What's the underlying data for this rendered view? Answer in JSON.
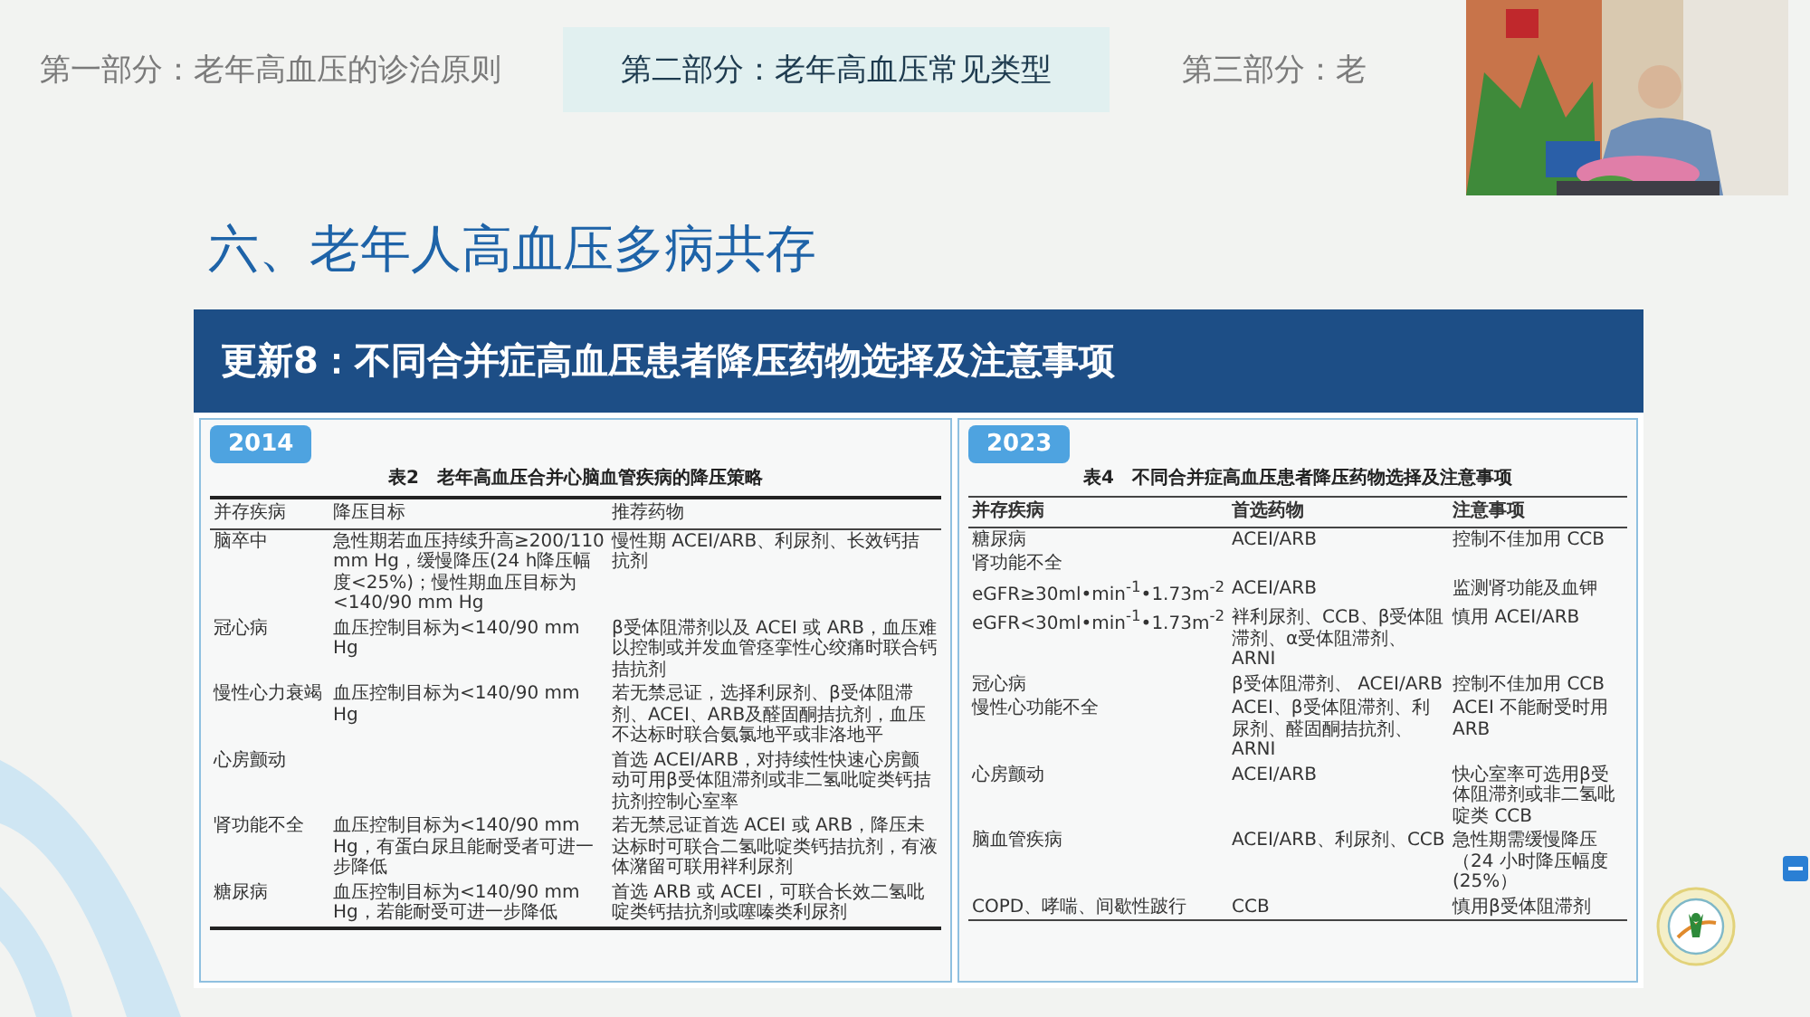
{
  "nav": {
    "tabs": [
      {
        "label": "第一部分：老年高血压的诊治原则",
        "selected": false
      },
      {
        "label": "第二部分：老年高血压常见类型",
        "selected": true
      },
      {
        "label": "第三部分：老",
        "selected": false
      }
    ]
  },
  "heading": "六、老年人高血压多病共存",
  "banner": "更新8：不同合并症高血压患者降压药物选择及注意事项",
  "panels": [
    {
      "year": "2014",
      "kind": "old",
      "table": {
        "title": "表2　老年高血压合并心脑血管疾病的降压策略",
        "columns": [
          "并存疾病",
          "降压目标",
          "推荐药物"
        ],
        "rows": [
          [
            "脑卒中",
            "急性期若血压持续升高≥200/110 mm Hg，缓慢降压(24 h降压幅度<25%)；慢性期血压目标为<140/90 mm Hg",
            "慢性期 ACEI/ARB、利尿剂、长效钙拮抗剂"
          ],
          [
            "冠心病",
            "血压控制目标为<140/90 mm Hg",
            "β受体阻滞剂以及 ACEI 或 ARB，血压难以控制或并发血管痉挛性心绞痛时联合钙拮抗剂"
          ],
          [
            "慢性心力衰竭",
            "血压控制目标为<140/90 mm Hg",
            "若无禁忌证，选择利尿剂、β受体阻滞剂、ACEI、ARB及醛固酮拮抗剂，血压不达标时联合氨氯地平或非洛地平"
          ],
          [
            "心房颤动",
            null,
            "首选 ACEI/ARB，对持续性快速心房颤动可用β受体阻滞剂或非二氢吡啶类钙拮抗剂控制心室率"
          ],
          [
            "肾功能不全",
            "血压控制目标为<140/90 mm Hg，有蛋白尿且能耐受者可进一步降低",
            "若无禁忌证首选 ACEI 或 ARB，降压未达标时可联合二氢吡啶类钙拮抗剂，有液体潴留可联用袢利尿剂"
          ],
          [
            "糖尿病",
            "血压控制目标为<140/90 mm Hg，若能耐受可进一步降低",
            "首选 ARB 或 ACEI，可联合长效二氢吡啶类钙拮抗剂或噻嗪类利尿剂"
          ]
        ]
      }
    },
    {
      "year": "2023",
      "kind": "new",
      "table": {
        "title": "表4　不同合并症高血压患者降压药物选择及注意事项",
        "columns": [
          "并存疾病",
          "首选药物",
          "注意事项"
        ],
        "rows": [
          [
            "糖尿病",
            "ACEI/ARB",
            "控制不佳加用 CCB"
          ],
          [
            "肾功能不全",
            null,
            null
          ],
          [
            "eGFR≥30ml•min$^{-1}$•1.73m$^{-2}$",
            "ACEI/ARB",
            "监测肾功能及血钾"
          ],
          [
            "eGFR<30ml•min$^{-1}$•1.73m$^{-2}$",
            "袢利尿剂、CCB、β受体阻滞剂、α受体阻滞剂、ARNI",
            "慎用 ACEI/ARB"
          ],
          [
            "冠心病",
            "β受体阻滞剂、 ACEI/ARB",
            "控制不佳加用 CCB"
          ],
          [
            "慢性心功能不全",
            "ACEI、β受体阻滞剂、利尿剂、醛固酮拮抗剂、ARNI",
            "ACEI 不能耐受时用 ARB"
          ],
          [
            "心房颤动",
            "ACEI/ARB",
            "快心室率可选用β受体阻滞剂或非二氢吡啶类 CCB"
          ],
          [
            "脑血管疾病",
            "ACEI/ARB、利尿剂、CCB",
            "急性期需缓慢降压（24 小时降压幅度(25%）"
          ],
          [
            "COPD、哮喘、间歇性跛行",
            "CCB",
            "慎用β受体阻滞剂"
          ]
        ]
      }
    }
  ]
}
